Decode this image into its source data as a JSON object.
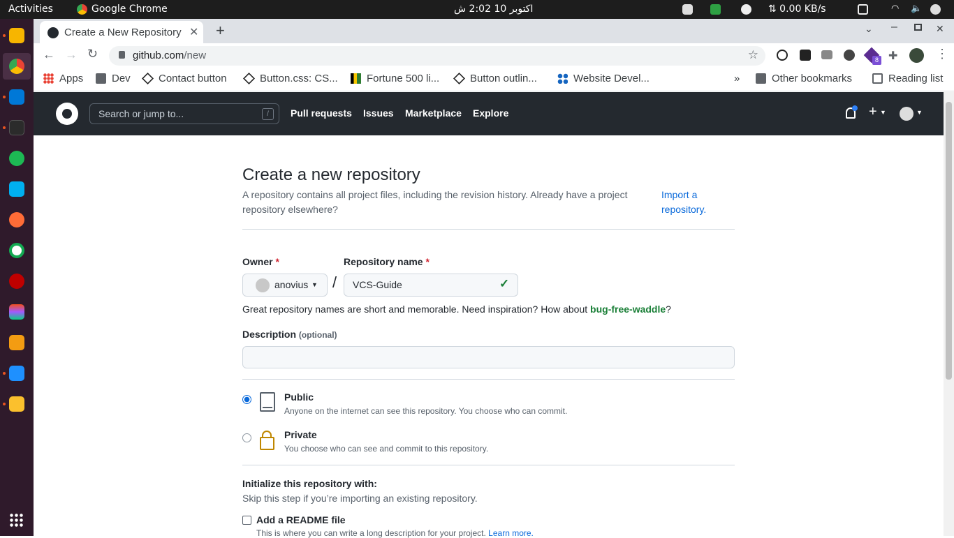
{
  "system": {
    "activities": "Activities",
    "app_name": "Google Chrome",
    "clock": "اکتوبر 10  2:02 ش",
    "net_speed": "⇅ 0.00 KB/s"
  },
  "browser": {
    "tab_title": "Create a New Repository",
    "url_host": "github.com",
    "url_path": "/new",
    "extension_badge": "8",
    "bookmarks": [
      "Apps",
      "Dev",
      "Contact button",
      "Button.css: CS...",
      "Fortune 500 li...",
      "Button outlin...",
      "Website Devel..."
    ],
    "more_bookmarks": "»",
    "other_bookmarks": "Other bookmarks",
    "reading_list": "Reading list"
  },
  "github": {
    "search_placeholder": "Search or jump to...",
    "search_shortcut": "/",
    "nav": [
      "Pull requests",
      "Issues",
      "Marketplace",
      "Explore"
    ]
  },
  "page": {
    "title": "Create a new repository",
    "subtitle": "A repository contains all project files, including the revision history. Already have a project repository elsewhere?",
    "import_link": "Import a repository.",
    "owner_label": "Owner",
    "required_mark": "*",
    "owner_value": "anovius",
    "separator": "/",
    "repo_label": "Repository name",
    "repo_value": "VCS-Guide",
    "hint_prefix": "Great repository names are short and memorable. Need inspiration? How about",
    "hint_suggestion": "bug-free-waddle",
    "hint_suffix": "?",
    "description_label": "Description",
    "description_optional": "(optional)",
    "description_value": "",
    "public_title": "Public",
    "public_desc": "Anyone on the internet can see this repository. You choose who can commit.",
    "private_title": "Private",
    "private_desc": "You choose who can see and commit to this repository.",
    "init_title": "Initialize this repository with:",
    "init_desc": "Skip this step if you’re importing an existing repository.",
    "readme_label": "Add a README file",
    "readme_desc": "This is where you can write a long description for your project.",
    "learn_more": "Learn more."
  },
  "colors": {
    "gh_header": "#24292f",
    "link": "#0969da",
    "success": "#1a7f37",
    "required": "#cf222e",
    "dock": "#2f1a2b"
  }
}
